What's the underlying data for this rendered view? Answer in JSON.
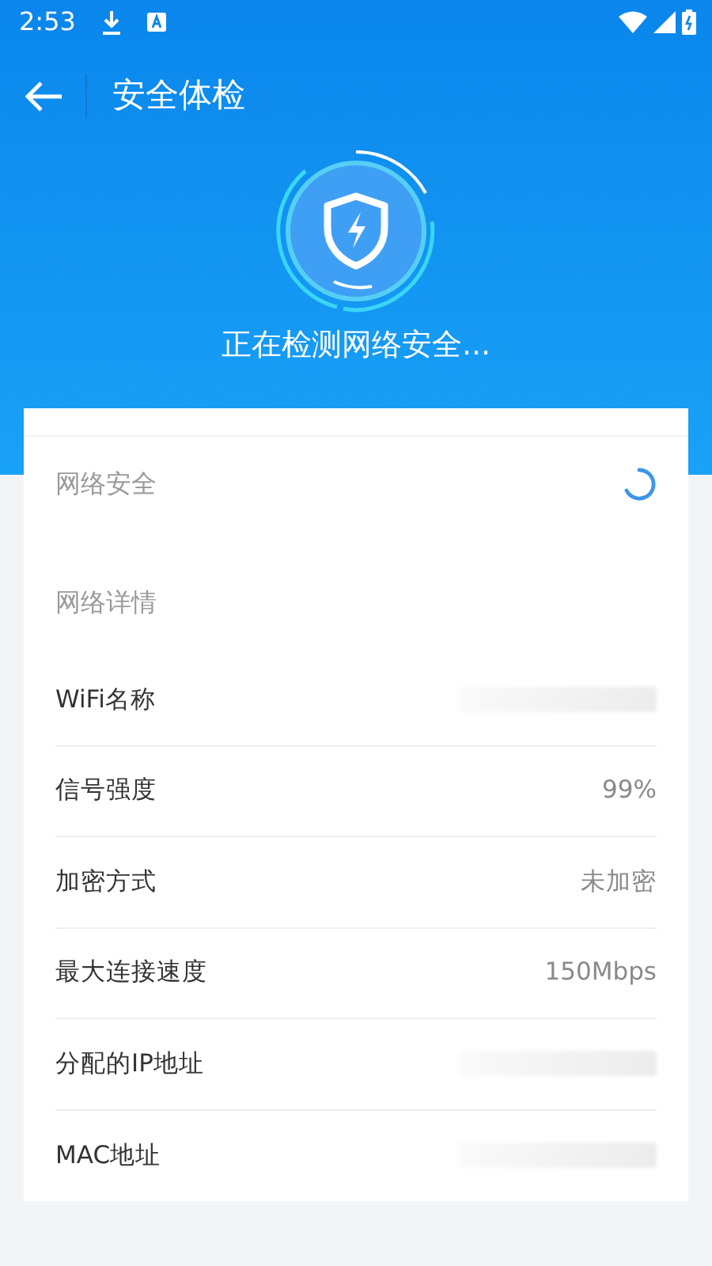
{
  "status_bar": {
    "time": "2:53"
  },
  "app_bar": {
    "title": "安全体检"
  },
  "scan": {
    "message": "正在检测网络安全..."
  },
  "security": {
    "label": "网络安全",
    "scanning": true
  },
  "details": {
    "heading": "网络详情",
    "rows": [
      {
        "label": "WiFi名称",
        "kind": "redacted"
      },
      {
        "label": "信号强度",
        "kind": "text",
        "value": "99%"
      },
      {
        "label": "加密方式",
        "kind": "text",
        "value": "未加密"
      },
      {
        "label": "最大连接速度",
        "kind": "text",
        "value": "150Mbps"
      },
      {
        "label": "分配的IP地址",
        "kind": "redacted"
      },
      {
        "label": "MAC地址",
        "kind": "redacted"
      }
    ]
  }
}
